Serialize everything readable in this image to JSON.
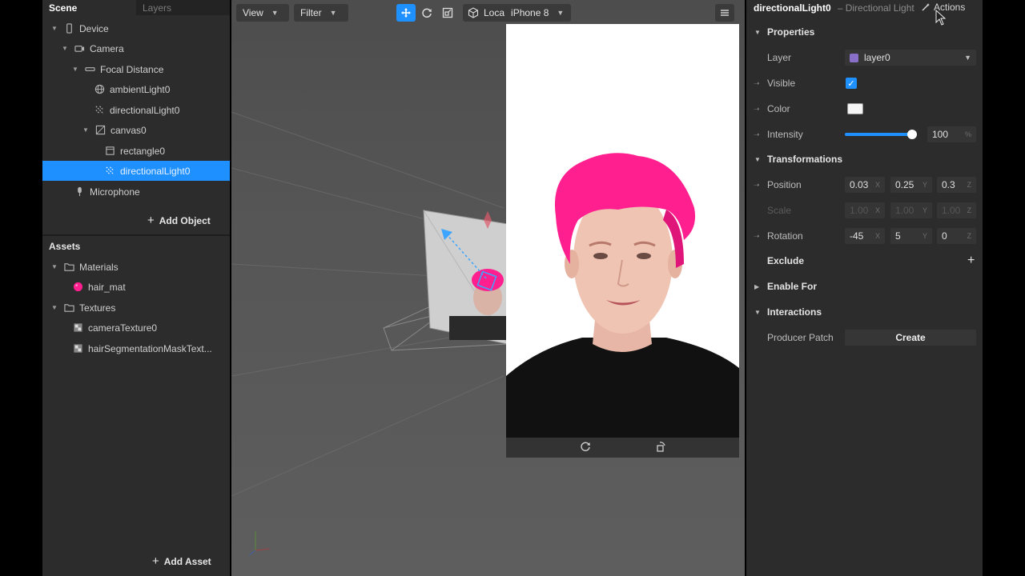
{
  "left": {
    "tabs": {
      "scene": "Scene",
      "layers": "Layers"
    },
    "tree": [
      {
        "label": "Device"
      },
      {
        "label": "Camera"
      },
      {
        "label": "Focal Distance"
      },
      {
        "label": "ambientLight0"
      },
      {
        "label": "directionalLight0"
      },
      {
        "label": "canvas0"
      },
      {
        "label": "rectangle0"
      },
      {
        "label": "directionalLight0"
      },
      {
        "label": "Microphone"
      }
    ],
    "add_object": "Add Object",
    "assets_title": "Assets",
    "assets": [
      {
        "label": "Materials"
      },
      {
        "label": "hair_mat"
      },
      {
        "label": "Textures"
      },
      {
        "label": "cameraTexture0"
      },
      {
        "label": "hairSegmentationMaskText..."
      }
    ],
    "add_asset": "Add Asset"
  },
  "viewport": {
    "view_label": "View",
    "filter_label": "Filter",
    "device_loc": "Loca",
    "device_name": "iPhone 8"
  },
  "right": {
    "title": "directionalLight0",
    "subtitle": "– Directional Light",
    "actions": "Actions",
    "properties": "Properties",
    "layer_label": "Layer",
    "layer_value": "layer0",
    "visible_label": "Visible",
    "color_label": "Color",
    "intensity_label": "Intensity",
    "intensity_value": "100",
    "intensity_unit": "%",
    "intensity_fraction": 1.0,
    "transformations": "Transformations",
    "position_label": "Position",
    "position": {
      "x": "0.03",
      "y": "0.25",
      "z": "0.3"
    },
    "scale_label": "Scale",
    "scale": {
      "x": "1.00",
      "y": "1.00",
      "z": "1.00"
    },
    "rotation_label": "Rotation",
    "rotation": {
      "x": "-45",
      "y": "5",
      "z": "0"
    },
    "axis": {
      "x": "X",
      "y": "Y",
      "z": "Z"
    },
    "exclude": "Exclude",
    "enable_for": "Enable For",
    "interactions": "Interactions",
    "producer_patch": "Producer Patch",
    "create": "Create"
  },
  "colors": {
    "accent": "#1e90ff",
    "hair": "#ff1f8e",
    "panel": "#2c2c2c"
  }
}
